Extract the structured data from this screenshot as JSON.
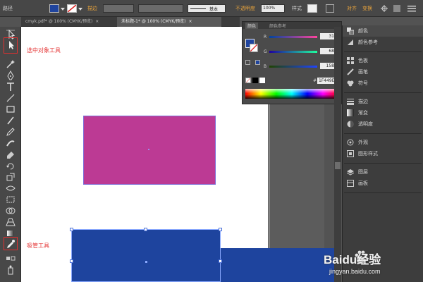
{
  "control_bar": {
    "label_path": "路径",
    "stroke_label": "描边",
    "stroke_style": "基本",
    "opacity_label": "不透明度",
    "opacity_value": "100%",
    "style_label": "样式",
    "recolor_label": "对齐",
    "transform_label": "变换"
  },
  "tabs": [
    {
      "label": "cmyk.pdf* @ 100% (CMYK/预览)"
    },
    {
      "label": "未标题-1* @ 100% (CMYK/预览)"
    }
  ],
  "tab_close": "×",
  "color_panel": {
    "tab_color": "颜色",
    "tab_guide": "颜色参考",
    "r_label": "R",
    "g_label": "G",
    "b_label": "B",
    "r_value": "31",
    "g_value": "68",
    "b_value": "158",
    "hex_symbol": "#",
    "hex_value": "1F449E"
  },
  "dock": {
    "items": [
      {
        "label": "颜色"
      },
      {
        "label": "颜色参考"
      },
      {
        "label": "色板"
      },
      {
        "label": "画笔"
      },
      {
        "label": "符号"
      },
      {
        "label": "描边"
      },
      {
        "label": "渐变"
      },
      {
        "label": "透明度"
      },
      {
        "label": "外观"
      },
      {
        "label": "图形样式"
      },
      {
        "label": "图层"
      },
      {
        "label": "画板"
      }
    ]
  },
  "annotations": {
    "select_tool": "选中对象工具",
    "eyedropper_tool": "吸管工具"
  },
  "colors": {
    "magenta_rect": "#BC3A94",
    "blue_rect": "#1E449E",
    "fill_swatch": "#1F449E"
  },
  "watermark": {
    "brand": "Baidu经验",
    "url": "jingyan.baidu.com"
  }
}
